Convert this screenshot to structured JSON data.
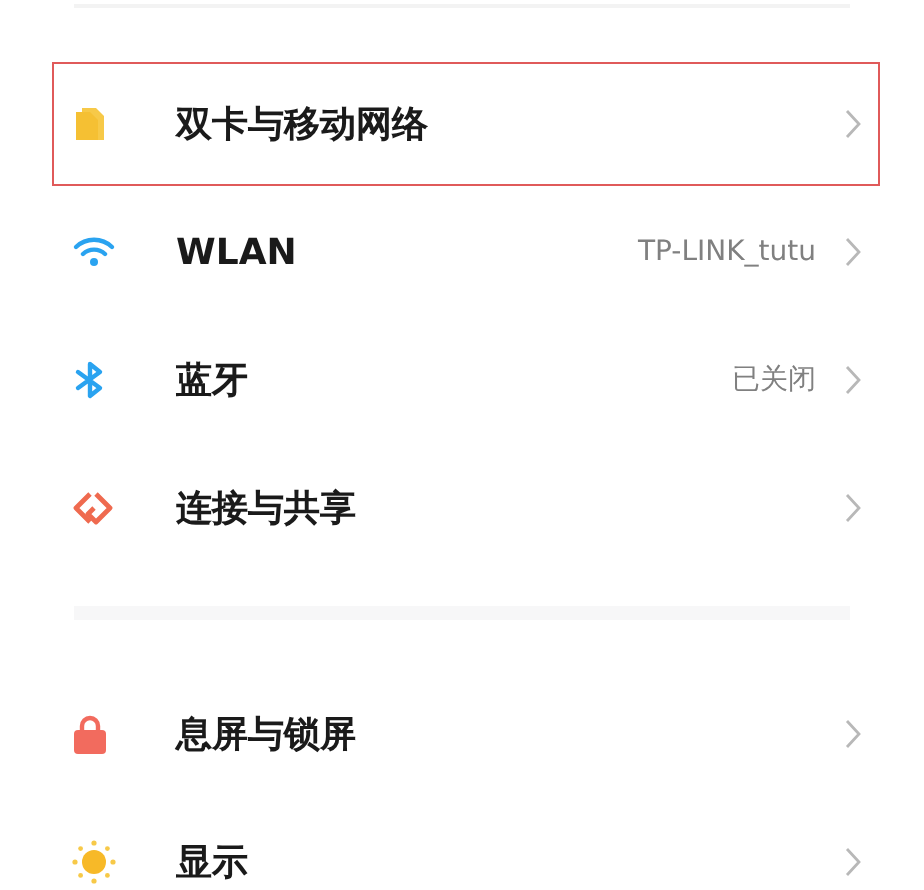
{
  "groups": [
    {
      "items": [
        {
          "label": "双卡与移动网络",
          "highlighted": true
        },
        {
          "label": "WLAN",
          "value": "TP-LINK_tutu",
          "highlighted": false
        },
        {
          "label": "蓝牙",
          "value": "已关闭",
          "highlighted": false
        },
        {
          "label": "连接与共享",
          "highlighted": false
        }
      ]
    },
    {
      "items": [
        {
          "label": "息屏与锁屏",
          "highlighted": false
        },
        {
          "label": "显示",
          "highlighted": false
        }
      ]
    }
  ]
}
